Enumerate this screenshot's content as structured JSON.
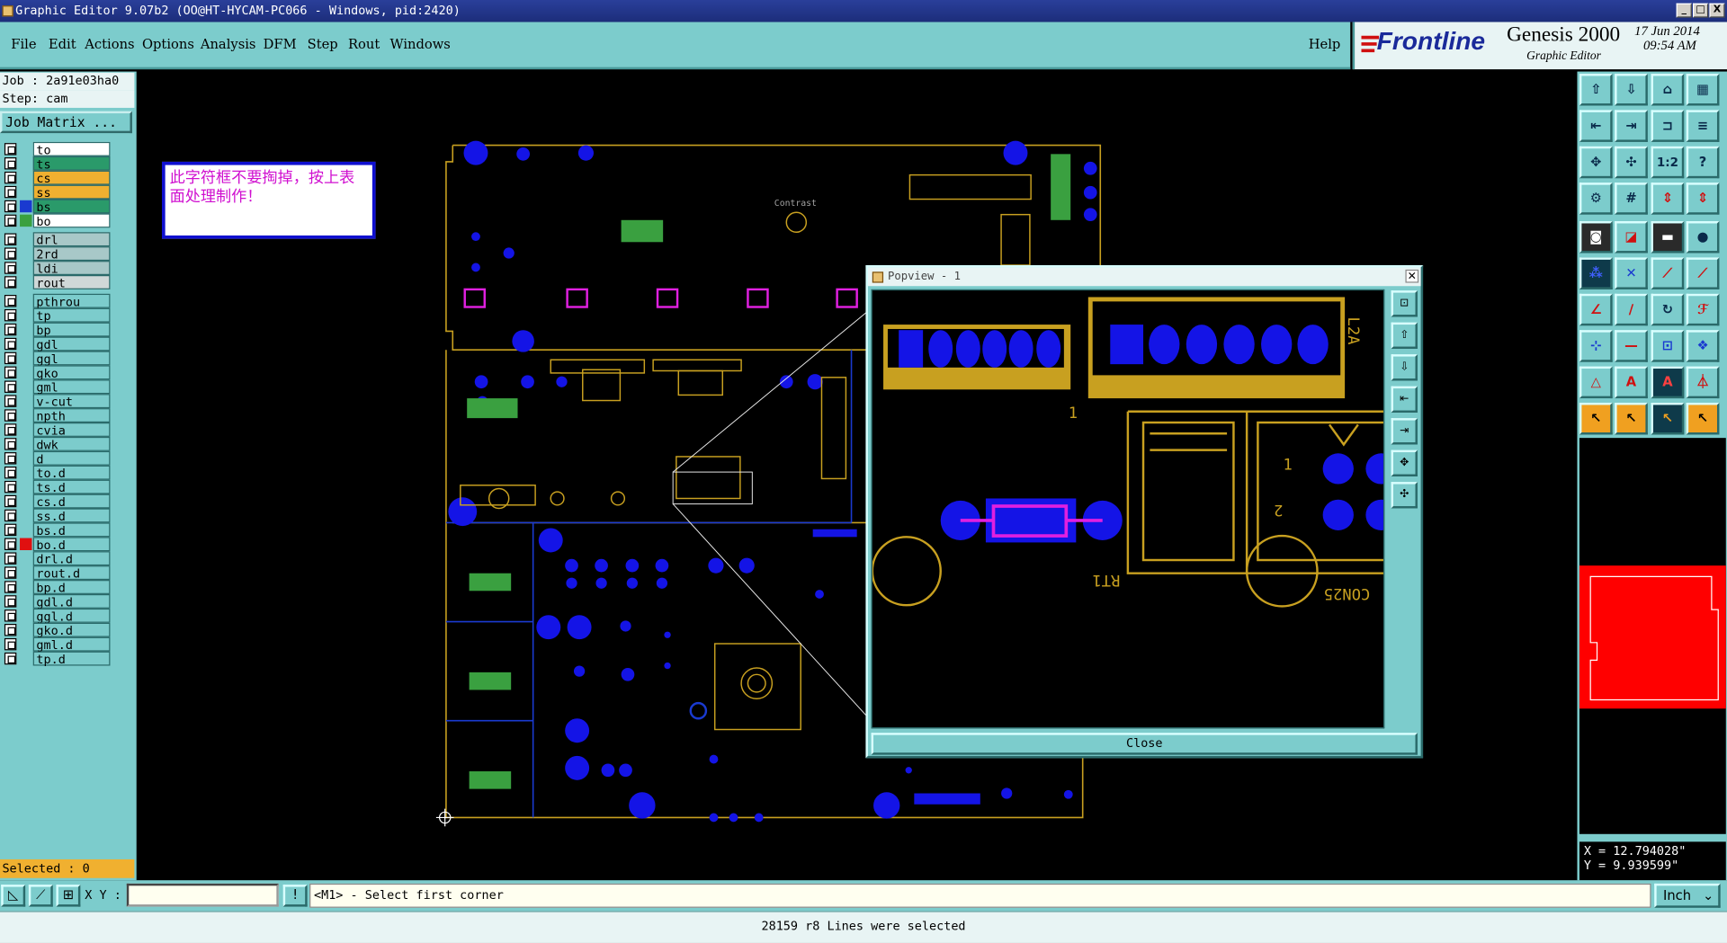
{
  "window": {
    "title": "Graphic Editor 9.07b2 (OO@HT-HYCAM-PC066 - Windows, pid:2420)",
    "min_label": "_",
    "max_label": "□",
    "close_label": "X"
  },
  "menu": {
    "items": [
      "File",
      "Edit",
      "Actions",
      "Options",
      "Analysis",
      "DFM",
      "Step",
      "Rout",
      "Windows"
    ],
    "help": "Help"
  },
  "brand": {
    "logo": "Frontline",
    "product": "Genesis 2000",
    "subtitle": "Graphic Editor",
    "date": "17 Jun 2014",
    "time": "09:54 AM"
  },
  "job": {
    "job_line": "Job : 2a91e03ha0",
    "step_line": "Step: cam",
    "matrix_button": "Job Matrix ..."
  },
  "layers": [
    {
      "name": "to",
      "color": "#ffffff"
    },
    {
      "name": "ts",
      "color": "#2a9a6a"
    },
    {
      "name": "cs",
      "color": "#f0b030"
    },
    {
      "name": "ss",
      "color": "#f0b030"
    },
    {
      "name": "bs",
      "color": "#2a9a6a",
      "swatch": "#1a3ad0"
    },
    {
      "name": "bo",
      "color": "#ffffff",
      "swatch": "#3aa040"
    },
    {
      "name": "drl",
      "color": "#a8c8c8"
    },
    {
      "name": "2rd",
      "color": "#a8c8c8"
    },
    {
      "name": "ldi",
      "color": "#a8c8c8"
    },
    {
      "name": "rout",
      "color": "#d0d8d8"
    },
    {
      "name": "pthrou",
      "color": "#7ccccc"
    },
    {
      "name": "tp",
      "color": "#7ccccc"
    },
    {
      "name": "bp",
      "color": "#7ccccc"
    },
    {
      "name": "gdl",
      "color": "#7ccccc"
    },
    {
      "name": "ggl",
      "color": "#7ccccc"
    },
    {
      "name": "gko",
      "color": "#7ccccc"
    },
    {
      "name": "gml",
      "color": "#7ccccc"
    },
    {
      "name": "v-cut",
      "color": "#7ccccc"
    },
    {
      "name": "npth",
      "color": "#7ccccc"
    },
    {
      "name": "cvia",
      "color": "#7ccccc"
    },
    {
      "name": "dwk",
      "color": "#7ccccc"
    },
    {
      "name": "d",
      "color": "#7ccccc"
    },
    {
      "name": "to.d",
      "color": "#7ccccc"
    },
    {
      "name": "ts.d",
      "color": "#7ccccc"
    },
    {
      "name": "cs.d",
      "color": "#7ccccc"
    },
    {
      "name": "ss.d",
      "color": "#7ccccc"
    },
    {
      "name": "bs.d",
      "color": "#7ccccc"
    },
    {
      "name": "bo.d",
      "color": "#7ccccc",
      "swatch": "#e01010"
    },
    {
      "name": "drl.d",
      "color": "#7ccccc"
    },
    {
      "name": "rout.d",
      "color": "#7ccccc"
    },
    {
      "name": "bp.d",
      "color": "#7ccccc"
    },
    {
      "name": "gdl.d",
      "color": "#7ccccc"
    },
    {
      "name": "ggl.d",
      "color": "#7ccccc"
    },
    {
      "name": "gko.d",
      "color": "#7ccccc"
    },
    {
      "name": "gml.d",
      "color": "#7ccccc"
    },
    {
      "name": "tp.d",
      "color": "#7ccccc"
    }
  ],
  "selected": "Selected : 0",
  "note_text": "此字符框不要掏掉，按上表面处理制作！",
  "canvas_labels": {
    "contrast": "Contrast",
    "rt1": "RT1",
    "con25": "CON25",
    "l2a": "L2A",
    "one": "1",
    "two": "2"
  },
  "popview": {
    "title": "Popview - 1",
    "close": "Close"
  },
  "coords": {
    "x": "X = 12.794028\"",
    "y": "Y = 9.939599\""
  },
  "bottom": {
    "xy_label": "X Y :",
    "xy_value": "",
    "prompt": "<M1> - Select first corner",
    "units": "Inch",
    "status": "28159 r8 Lines were selected"
  },
  "colors": {
    "bg_teal": "#7ccccc",
    "pad_blue": "#1414e6",
    "outline_gold": "#c8a020",
    "silk_green": "#3aa040",
    "magenta": "#e020e0"
  }
}
